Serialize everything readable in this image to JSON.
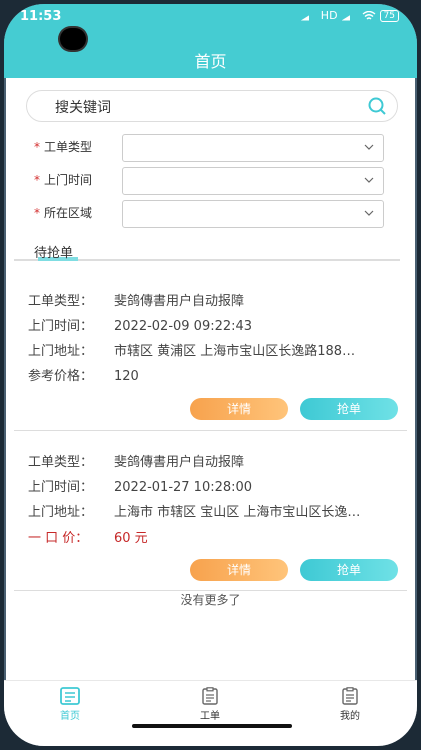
{
  "status_bar": {
    "time": "11:53",
    "network": "HD",
    "battery": "75"
  },
  "header": {
    "title": "首页"
  },
  "search": {
    "placeholder": "搜关键词"
  },
  "form": {
    "fields": [
      {
        "label": "工单类型",
        "required_mark": "*"
      },
      {
        "label": "上门时间",
        "required_mark": "*"
      },
      {
        "label": "所在区域",
        "required_mark": "*"
      }
    ]
  },
  "tabs": {
    "active": "待抢单"
  },
  "orders": [
    {
      "type_label": "工单类型：",
      "type_value": "斐鸽傳書用户自动报障",
      "time_label": "上门时间：",
      "time_value": "2022-02-09 09:22:43",
      "addr_label": "上门地址：",
      "addr_value": "市辖区 黄浦区 上海市宝山区长逸路188…",
      "price_label": "参考价格：",
      "price_value": "120",
      "detail_label": "详情",
      "grab_label": "抢单"
    },
    {
      "type_label": "工单类型：",
      "type_value": "斐鸽傳書用户自动报障",
      "time_label": "上门时间：",
      "time_value": "2022-01-27 10:28:00",
      "addr_label": "上门地址：",
      "addr_value": "上海市 市辖区 宝山区 上海市宝山区长逸…",
      "price_label": "一 口 价：",
      "price_value": "60 元",
      "detail_label": "详情",
      "grab_label": "抢单"
    }
  ],
  "list_footer": "没有更多了",
  "bottom_nav": [
    {
      "label": "首页",
      "active": true
    },
    {
      "label": "工单",
      "active": false
    },
    {
      "label": "我的",
      "active": false
    }
  ],
  "colors": {
    "accent": "#45ccd2",
    "price_red": "#c62828",
    "detail_orange": "#f7a24d"
  }
}
